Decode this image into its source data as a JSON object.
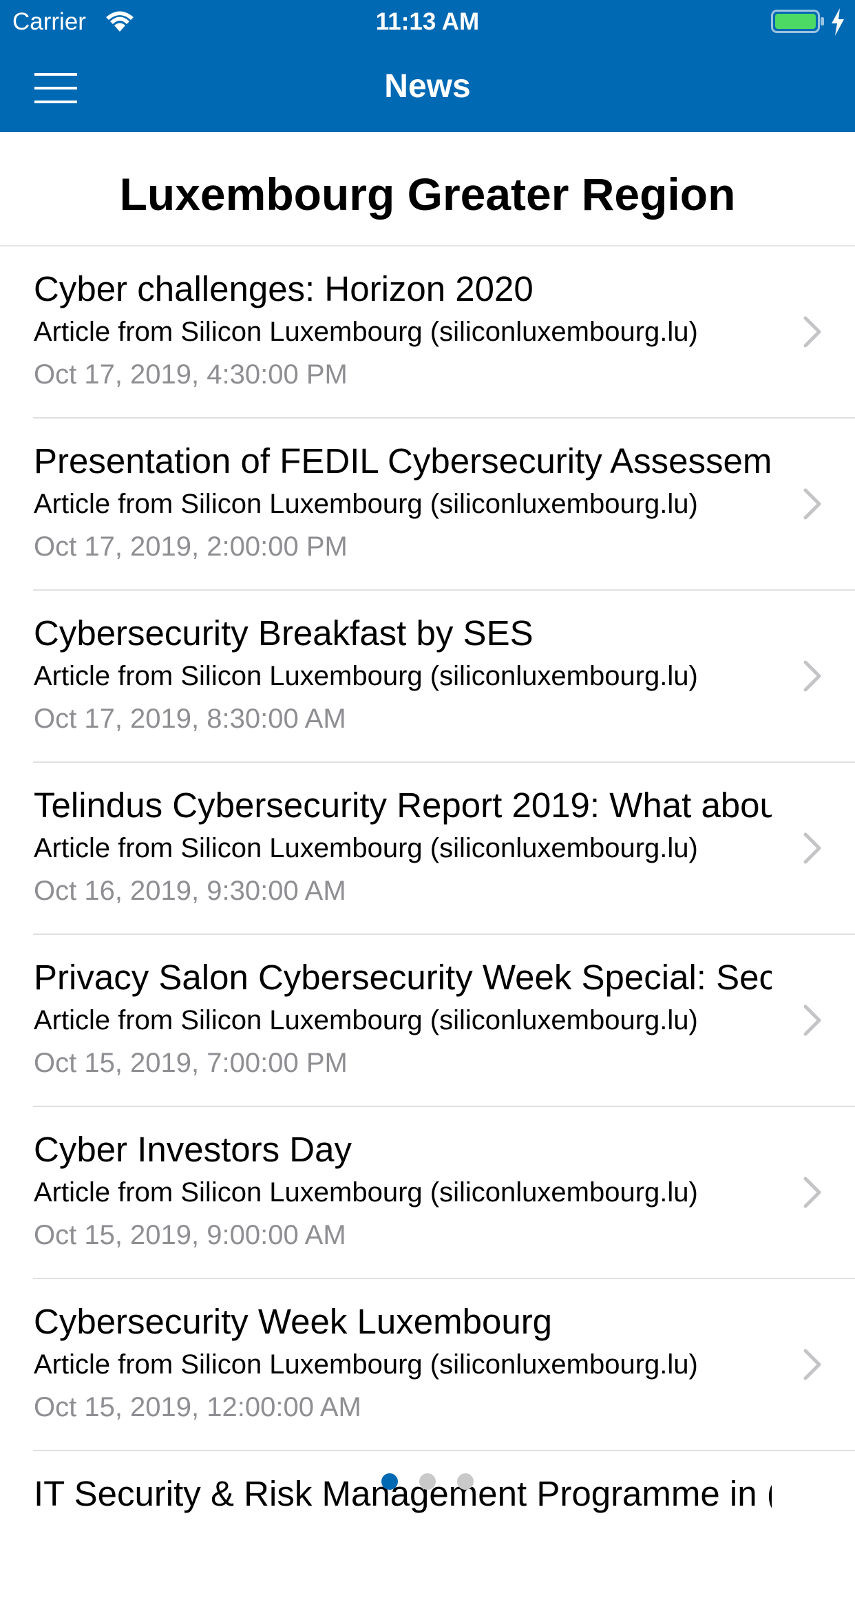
{
  "status_bar": {
    "carrier": "Carrier",
    "time": "11:13 AM",
    "battery_color": "#4cd964"
  },
  "nav": {
    "title": "News",
    "menu_icon": "hamburger-menu-icon",
    "bar_color": "#0069b4"
  },
  "page": {
    "title": "Luxembourg Greater Region"
  },
  "news_items": [
    {
      "title": "Cyber challenges: Horizon 2020",
      "source": "Article from Silicon Luxembourg (siliconluxembourg.lu)",
      "date": "Oct 17, 2019, 4:30:00 PM"
    },
    {
      "title": "Presentation of FEDIL Cybersecurity Assessem",
      "source": "Article from Silicon Luxembourg (siliconluxembourg.lu)",
      "date": "Oct 17, 2019, 2:00:00 PM"
    },
    {
      "title": "Cybersecurity Breakfast by SES",
      "source": "Article from Silicon Luxembourg (siliconluxembourg.lu)",
      "date": "Oct 17, 2019, 8:30:00 AM"
    },
    {
      "title": "Telindus Cybersecurity Report 2019: What abou",
      "source": "Article from Silicon Luxembourg (siliconluxembourg.lu)",
      "date": "Oct 16, 2019, 9:30:00 AM"
    },
    {
      "title": "Privacy Salon Cybersecurity Week Special: Sec",
      "source": "Article from Silicon Luxembourg (siliconluxembourg.lu)",
      "date": "Oct 15, 2019, 7:00:00 PM"
    },
    {
      "title": "Cyber Investors Day",
      "source": "Article from Silicon Luxembourg (siliconluxembourg.lu)",
      "date": "Oct 15, 2019, 9:00:00 AM"
    },
    {
      "title": "Cybersecurity Week Luxembourg",
      "source": "Article from Silicon Luxembourg (siliconluxembourg.lu)",
      "date": "Oct 15, 2019, 12:00:00 AM"
    },
    {
      "title": "IT Security & Risk Management Programme in (",
      "source": "",
      "date": ""
    }
  ],
  "pager": {
    "pages": 3,
    "current_page": 1,
    "active_color": "#0069b4"
  }
}
